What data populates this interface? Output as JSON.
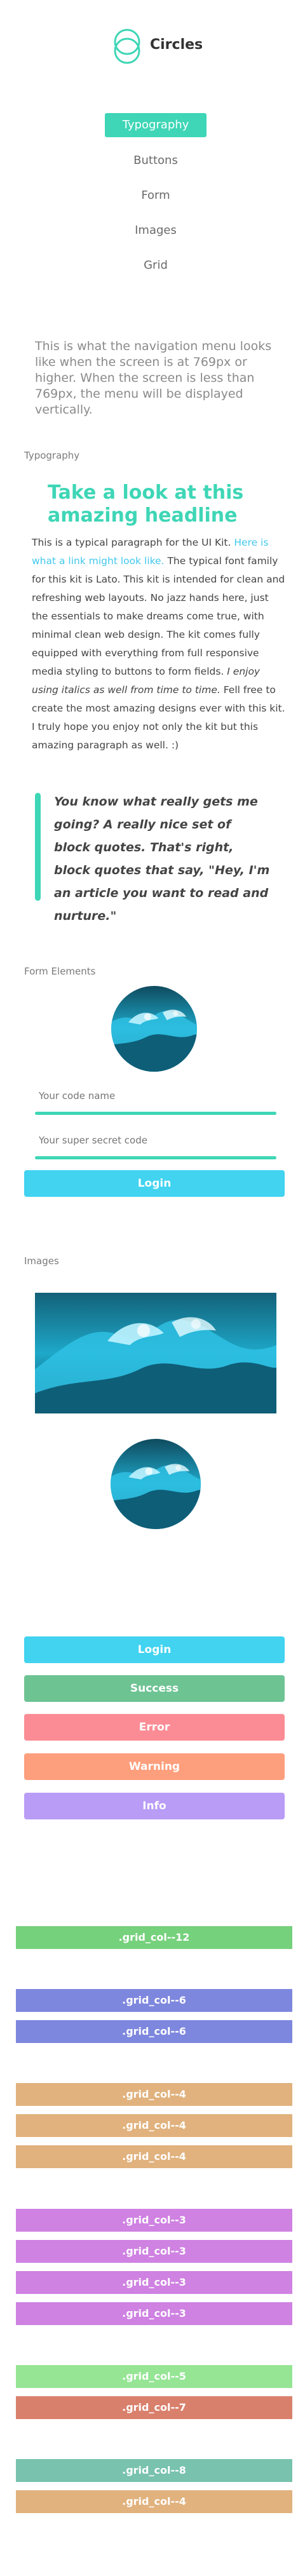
{
  "header": {
    "brand": "Circles",
    "logo_icon": "circles-logo-icon"
  },
  "nav": {
    "items": [
      "Typography",
      "Buttons",
      "Form",
      "Images",
      "Grid"
    ],
    "active": "Typography",
    "note": "This is what the navigation menu looks like when the screen is at 769px or higher. When the screen is less than 769px, the menu will be displayed vertically."
  },
  "typography": {
    "section_label": "Typography",
    "headline": "Take a look at this amazing headline",
    "para_intro": "This is a typical paragraph for the UI Kit. ",
    "para_link": "Here is what a link might look like.",
    "para_middle": " The typical font family for this kit is Lato. This kit is intended for clean and refreshing web layouts. No jazz hands here, just the essentials to make dreams come true, with minimal clean web design. The kit comes fully equipped with everything from full responsive media styling to buttons to form fields. ",
    "para_italic": "I enjoy using italics as well from time to time.",
    "para_end": " Fell free to create the most amazing designs ever with this kit. I truly hope you enjoy not only the kit but this amazing paragraph as well. :)",
    "blockquote": "You know what really gets me going? A really nice set of block quotes. That's right, block quotes that say, \"Hey, I'm an article you want to read and nurture.\""
  },
  "form": {
    "section_label": "Form Elements",
    "code_name_placeholder": "Your code name",
    "secret_code_placeholder": "Your super secret code",
    "login_label": "Login"
  },
  "images": {
    "section_label": "Images"
  },
  "buttons": [
    {
      "label": "Login",
      "color": "#41d3f0"
    },
    {
      "label": "Success",
      "color": "#6ec393"
    },
    {
      "label": "Error",
      "color": "#fb8c95"
    },
    {
      "label": "Warning",
      "color": "#fd9e7c"
    },
    {
      "label": "Info",
      "color": "#b89cf6"
    }
  ],
  "grid": [
    {
      "label": ".grid_col--12",
      "color": "#76d17c"
    },
    {
      "label": ".grid_col--6",
      "color": "#7e87de"
    },
    {
      "label": ".grid_col--6",
      "color": "#7e87de"
    },
    {
      "label": ".grid_col--4",
      "color": "#e1b27e"
    },
    {
      "label": ".grid_col--4",
      "color": "#e1b27e"
    },
    {
      "label": ".grid_col--4",
      "color": "#e1b27e"
    },
    {
      "label": ".grid_col--3",
      "color": "#cf82e2"
    },
    {
      "label": ".grid_col--3",
      "color": "#cf82e2"
    },
    {
      "label": ".grid_col--3",
      "color": "#cf82e2"
    },
    {
      "label": ".grid_col--3",
      "color": "#cf82e2"
    },
    {
      "label": ".grid_col--5",
      "color": "#95e595"
    },
    {
      "label": ".grid_col--7",
      "color": "#d9806c"
    },
    {
      "label": ".grid_col--8",
      "color": "#78c2ae"
    },
    {
      "label": ".grid_col--4",
      "color": "#e1b27e"
    },
    {
      "label": ".grid_col--7",
      "color": "#d9806c"
    }
  ],
  "accent": "#3ed6b6"
}
